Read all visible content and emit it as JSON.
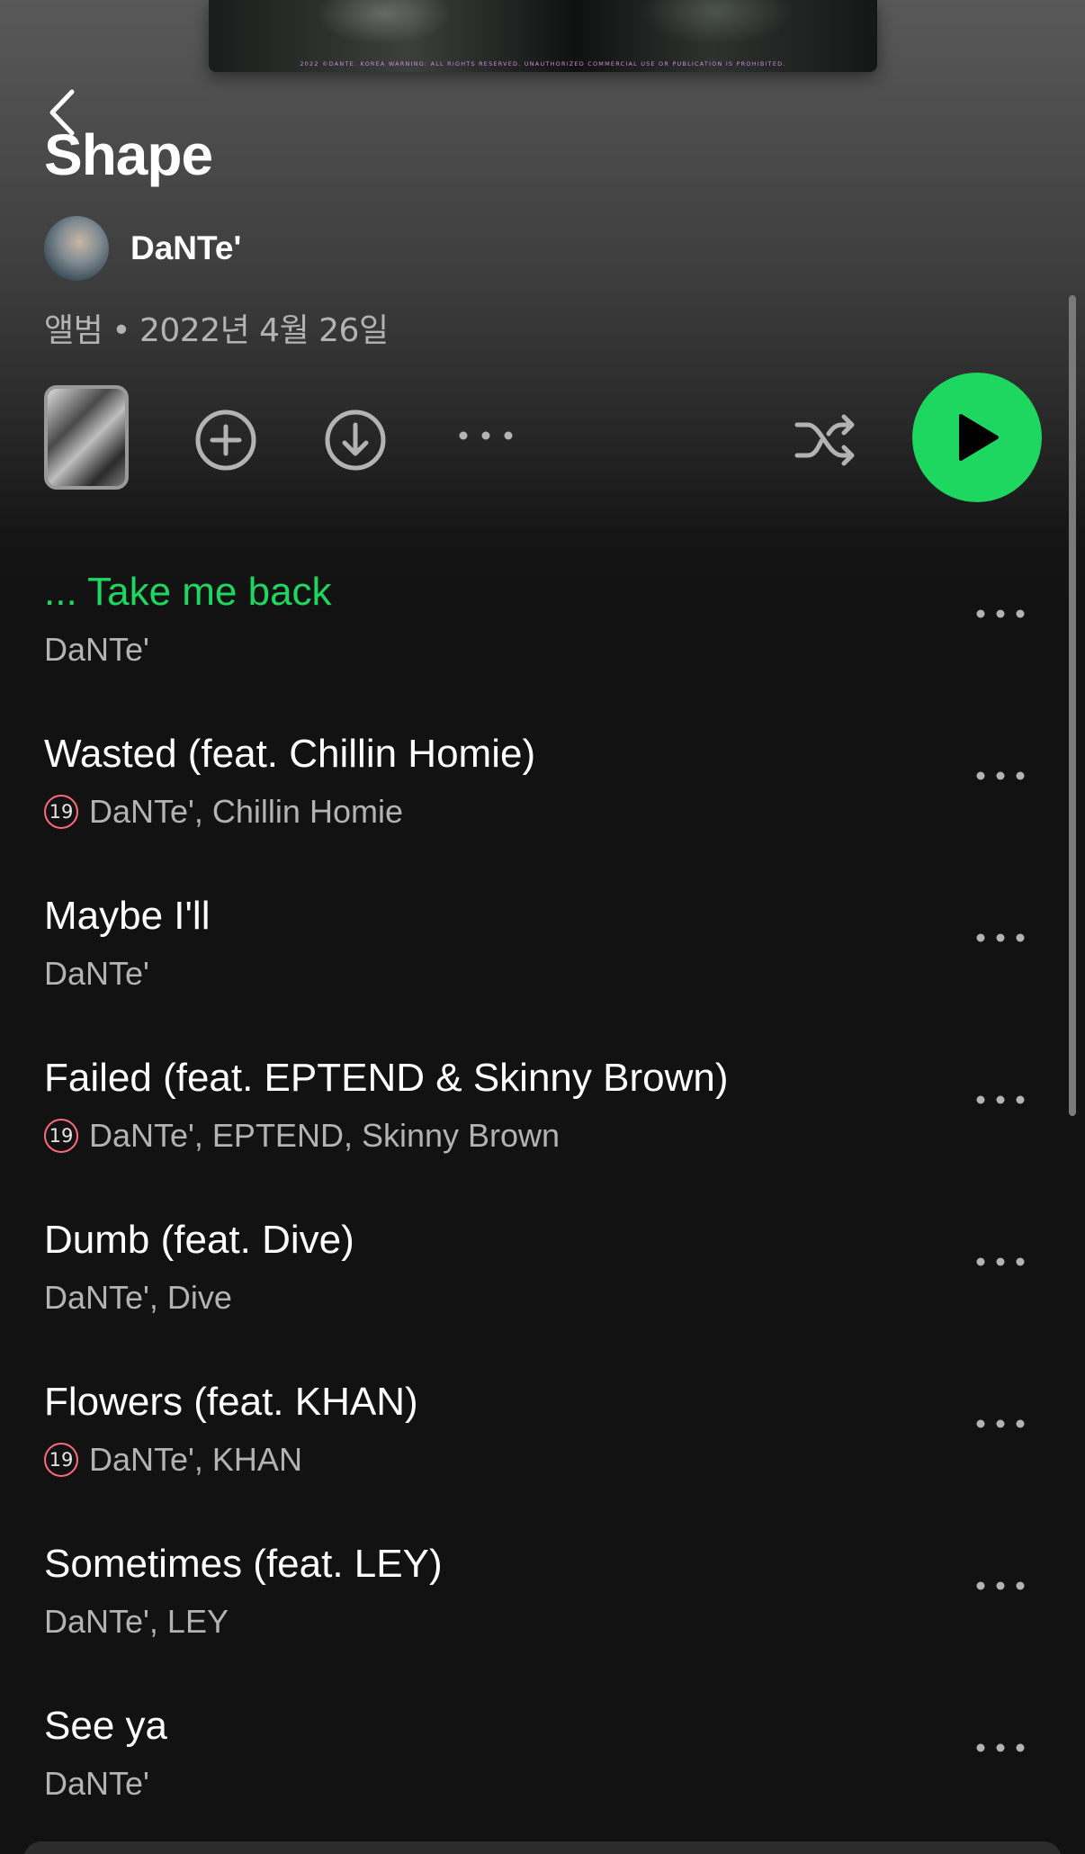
{
  "cover": {
    "fine_print": "2022 ©DANTE. KOREA WARNING: ALL RIGHTS RESERVED. UNAUTHORIZED COMMERCIAL USE OR PUBLICATION IS PROHIBITED."
  },
  "album": {
    "title": "Shape",
    "artist": "DaNTe'",
    "type": "앨범",
    "separator": "•",
    "release_date": "2022년 4월 26일"
  },
  "icons": {
    "back": "chevron-left-icon",
    "add": "plus-circle-icon",
    "download": "download-circle-icon",
    "more": "more-horizontal-icon",
    "shuffle": "shuffle-icon",
    "play": "play-icon"
  },
  "colors": {
    "accent": "#1ed760",
    "background": "#121212",
    "secondary_text": "#b3b3b3",
    "explicit_badge": "#ff6b7a"
  },
  "explicit_badge_label": "19",
  "tracks": [
    {
      "title": "... Take me back",
      "artists": "DaNTe'",
      "explicit": false,
      "playing": true
    },
    {
      "title": "Wasted (feat. Chillin Homie)",
      "artists": "DaNTe', Chillin Homie",
      "explicit": true,
      "playing": false
    },
    {
      "title": "Maybe I'll",
      "artists": "DaNTe'",
      "explicit": false,
      "playing": false
    },
    {
      "title": "Failed (feat. EPTEND & Skinny Brown)",
      "artists": "DaNTe', EPTEND, Skinny Brown",
      "explicit": true,
      "playing": false
    },
    {
      "title": "Dumb (feat. Dive)",
      "artists": "DaNTe', Dive",
      "explicit": false,
      "playing": false
    },
    {
      "title": "Flowers (feat. KHAN)",
      "artists": "DaNTe', KHAN",
      "explicit": true,
      "playing": false
    },
    {
      "title": "Sometimes (feat. LEY)",
      "artists": "DaNTe', LEY",
      "explicit": false,
      "playing": false
    },
    {
      "title": "See ya",
      "artists": "DaNTe'",
      "explicit": false,
      "playing": false
    }
  ]
}
